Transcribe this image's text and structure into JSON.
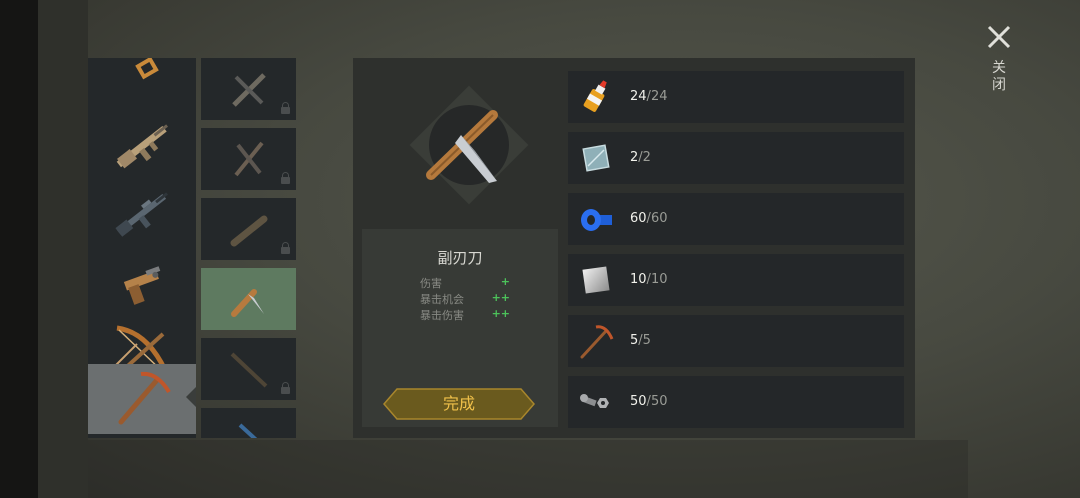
{
  "close": {
    "label": "关闭"
  },
  "categories": [
    {
      "icon": "partial-weapon-icon",
      "selected": false
    },
    {
      "icon": "assault-rifle-icon",
      "selected": false
    },
    {
      "icon": "rifle-icon",
      "selected": false
    },
    {
      "icon": "pistol-icon",
      "selected": false
    },
    {
      "icon": "crossbow-icon",
      "selected": false
    },
    {
      "icon": "pickaxe-icon",
      "selected": true
    }
  ],
  "items": [
    {
      "icon": "crossed-tools-icon",
      "locked": true,
      "selected": false
    },
    {
      "icon": "crossed-tools-icon",
      "locked": true,
      "selected": false
    },
    {
      "icon": "club-icon",
      "locked": true,
      "selected": false
    },
    {
      "icon": "dagger-icon",
      "locked": false,
      "selected": true
    },
    {
      "icon": "stick-icon",
      "locked": true,
      "selected": false
    },
    {
      "icon": "blue-item-icon",
      "locked": false,
      "selected": false
    }
  ],
  "detail": {
    "name": "副刃刀",
    "stats": [
      {
        "label": "伤害",
        "value": "+"
      },
      {
        "label": "暴击机会",
        "value": "++"
      },
      {
        "label": "暴击伤害",
        "value": "++"
      }
    ],
    "done_label": "完成"
  },
  "materials": [
    {
      "icon": "glue-icon",
      "have": "24",
      "need": "24"
    },
    {
      "icon": "glass-icon",
      "have": "2",
      "need": "2"
    },
    {
      "icon": "tape-icon",
      "have": "60",
      "need": "60"
    },
    {
      "icon": "metal-sheet-icon",
      "have": "10",
      "need": "10"
    },
    {
      "icon": "pickaxe-icon",
      "have": "5",
      "need": "5"
    },
    {
      "icon": "nuts-bolts-icon",
      "have": "50",
      "need": "50"
    }
  ],
  "colors": {
    "accent_gold": "#f0c04a",
    "stat_green": "#4cc25a",
    "selected_item": "#5e7a60"
  }
}
